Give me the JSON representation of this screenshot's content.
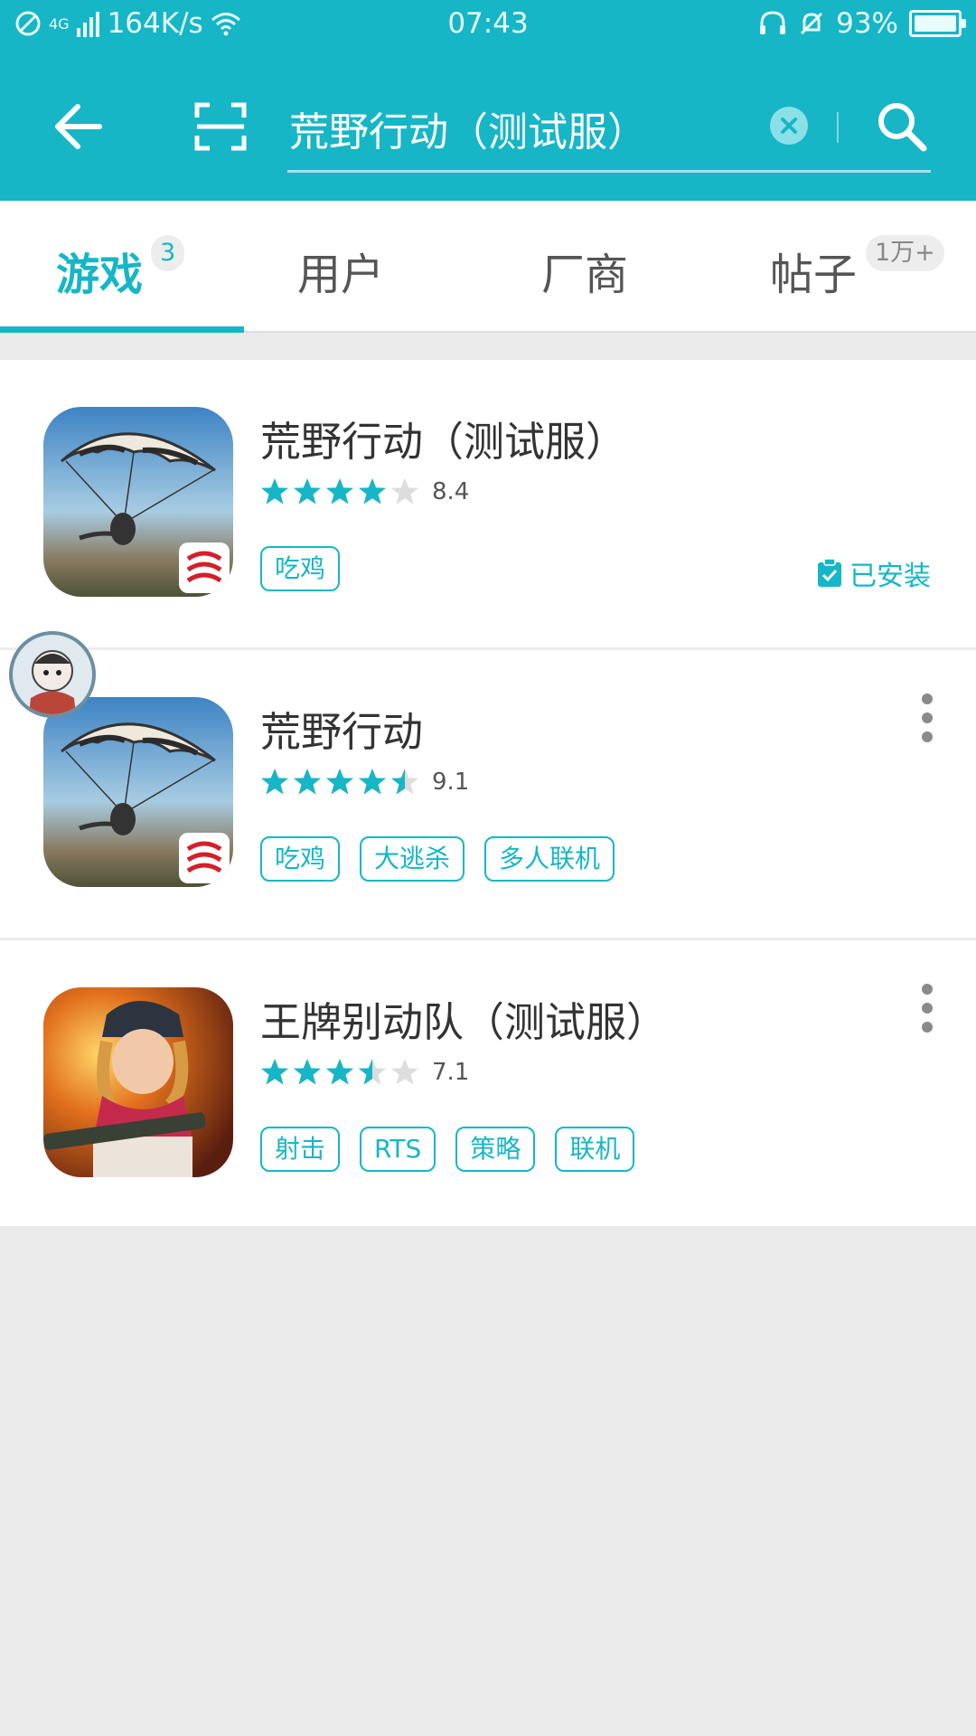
{
  "status_bar": {
    "network": "4G",
    "speed": "164K/s",
    "time": "07:43",
    "battery": "93%"
  },
  "search": {
    "query": "荒野行动（测试服）"
  },
  "tabs": [
    {
      "label": "游戏",
      "badge": "3",
      "active": true
    },
    {
      "label": "用户",
      "badge": "",
      "active": false
    },
    {
      "label": "厂商",
      "badge": "",
      "active": false
    },
    {
      "label": "帖子",
      "badge": "1万+",
      "active": false
    }
  ],
  "results": [
    {
      "name": "荒野行动（测试服）",
      "rating": "8.4",
      "stars": 4.0,
      "tags": [
        "吃鸡"
      ],
      "installed_label": "已安装",
      "icon": "parachute-game-icon"
    },
    {
      "name": "荒野行动",
      "rating": "9.1",
      "stars": 4.5,
      "tags": [
        "吃鸡",
        "大逃杀",
        "多人联机"
      ],
      "icon": "parachute-game-icon"
    },
    {
      "name": "王牌别动队（测试服）",
      "rating": "7.1",
      "stars": 3.5,
      "tags": [
        "射击",
        "RTS",
        "策略",
        "联机"
      ],
      "icon": "soldier-girl-game-icon"
    }
  ],
  "colors": {
    "accent": "#16b6c6",
    "background": "#ebebeb",
    "star_off": "#dddddd"
  }
}
